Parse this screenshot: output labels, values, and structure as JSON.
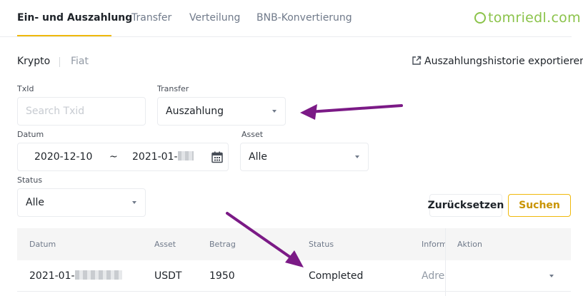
{
  "tabs": [
    {
      "label": "Ein- und Auszahlung",
      "active": true
    },
    {
      "label": "Transfer",
      "active": false
    },
    {
      "label": "Verteilung",
      "active": false
    },
    {
      "label": "BNB-Konvertierung",
      "active": false
    }
  ],
  "watermark": "tomriedl.com",
  "subtabs": {
    "crypto": "Krypto",
    "fiat": "Fiat"
  },
  "export_label": "Auszahlungshistorie exportieren",
  "form": {
    "txid_label": "TxId",
    "txid_placeholder": "Search Txid",
    "transfer_label": "Transfer",
    "transfer_value": "Auszahlung",
    "date_label": "Datum",
    "date_start": "2020-12-10",
    "date_separator": "~",
    "date_end": "2021-01-",
    "asset_label": "Asset",
    "asset_value": "Alle",
    "status_label": "Status",
    "status_value": "Alle",
    "reset_button": "Zurücksetzen",
    "search_button": "Suchen"
  },
  "table": {
    "headers": [
      "Datum",
      "Asset",
      "Betrag",
      "Status",
      "Inform",
      "Aktion"
    ],
    "rows": [
      {
        "date": "2021-01-",
        "asset": "USDT",
        "amount": "1950",
        "status": "Completed",
        "info": "Adres"
      }
    ]
  },
  "colors": {
    "accent": "#f0b90b",
    "annotation_arrow": "#7b1a86",
    "watermark": "#8bc34a"
  },
  "icons": [
    "export-icon",
    "calendar-icon",
    "chevron-down-icon"
  ]
}
